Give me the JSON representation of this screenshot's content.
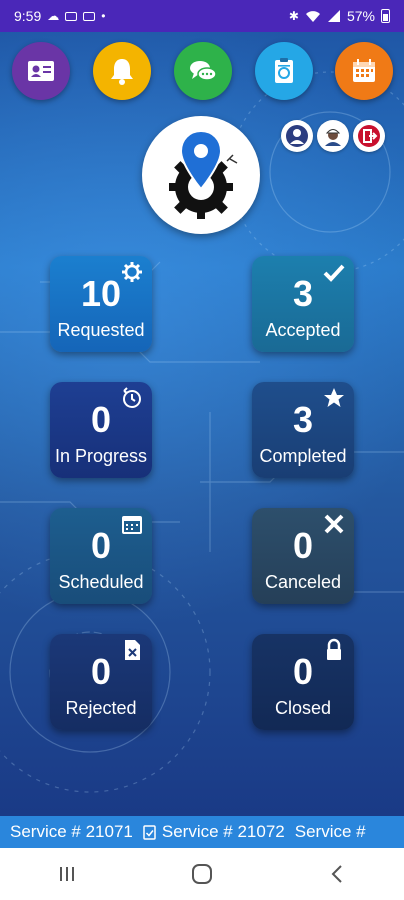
{
  "status_bar": {
    "time": "9:59",
    "left_icons": [
      "cloud-icon",
      "mail-icon",
      "gmail-icon",
      "dot-icon"
    ],
    "right_icons": [
      "bluetooth-icon",
      "wifi-icon",
      "signal-icon"
    ],
    "battery": "57%"
  },
  "top_icons": [
    {
      "name": "profile-card-icon",
      "color": "#6a35a6"
    },
    {
      "name": "bell-icon",
      "color": "#f4b400"
    },
    {
      "name": "chat-icon",
      "color": "#2eb24a"
    },
    {
      "name": "clipboard-icon",
      "color": "#25a7e6"
    },
    {
      "name": "calendar-icon",
      "color": "#f07a16"
    }
  ],
  "small_icons": [
    "technician-icon",
    "worker-icon",
    "logout-icon"
  ],
  "colors": {
    "status_bar": "#4a27b8",
    "ticker": "#2a86dc",
    "accent": "#1f6fd6"
  },
  "tiles": [
    {
      "count": "10",
      "label": "Requested",
      "icon": "gear-icon"
    },
    {
      "count": "3",
      "label": "Accepted",
      "icon": "check-icon"
    },
    {
      "count": "0",
      "label": "In Progress",
      "icon": "clock-icon"
    },
    {
      "count": "3",
      "label": "Completed",
      "icon": "star-icon"
    },
    {
      "count": "0",
      "label": "Scheduled",
      "icon": "calendar-icon"
    },
    {
      "count": "0",
      "label": "Canceled",
      "icon": "x-icon"
    },
    {
      "count": "0",
      "label": "Rejected",
      "icon": "document-x-icon"
    },
    {
      "count": "0",
      "label": "Closed",
      "icon": "lock-icon"
    }
  ],
  "ticker": [
    "Service # 21071",
    "Service # 21072",
    "Service #"
  ]
}
